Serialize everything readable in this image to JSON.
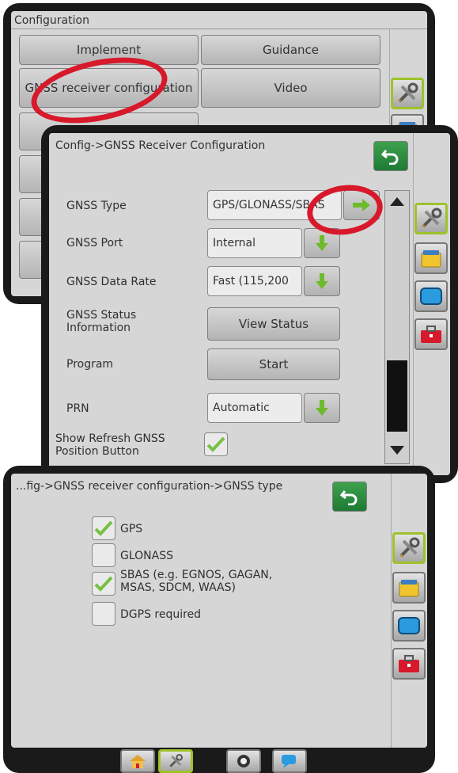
{
  "config_screen": {
    "title": "Configuration",
    "buttons": {
      "implement": "Implement",
      "guidance": "Guidance",
      "gnss_receiver": "GNSS receiver configuration",
      "video": "Video"
    }
  },
  "gnss_screen": {
    "title": "Config->GNSS Receiver Configuration",
    "rows": {
      "gnss_type": {
        "label": "GNSS Type",
        "value": "GPS/GLONASS/SBAS"
      },
      "gnss_port": {
        "label": "GNSS Port",
        "value": "Internal"
      },
      "gnss_data_rate": {
        "label": "GNSS Data Rate",
        "value": "Fast (115,200"
      },
      "gnss_status": {
        "label": "GNSS Status Information",
        "button": "View Status"
      },
      "program": {
        "label": "Program",
        "button": "Start"
      },
      "prn": {
        "label": "PRN",
        "value": "Automatic"
      },
      "show_refresh": {
        "label": "Show Refresh GNSS Position Button",
        "checked": true
      }
    }
  },
  "type_screen": {
    "title": "...fig->GNSS receiver configuration->GNSS type",
    "options": [
      {
        "label": "GPS",
        "checked": true
      },
      {
        "label": "GLONASS",
        "checked": false
      },
      {
        "label": "SBAS (e.g. EGNOS, GAGAN, MSAS, SDCM, WAAS)",
        "checked": true
      },
      {
        "label": "DGPS required",
        "checked": false
      }
    ]
  },
  "side_tabs": [
    "tools-icon",
    "folder-icon",
    "screen-icon",
    "toolbox-icon"
  ],
  "bottom_nav": [
    "home-icon",
    "tools-icon",
    "camera-icon",
    "chat-icon"
  ],
  "colors": {
    "accent_green": "#9ec22a",
    "highlight_red": "#d7192b",
    "bezel": "#1a1a1a"
  }
}
